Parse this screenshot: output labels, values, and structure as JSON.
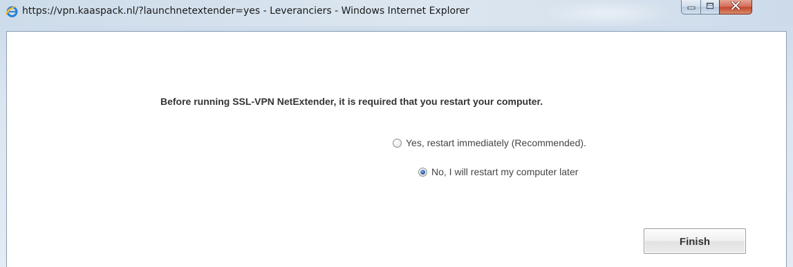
{
  "window": {
    "title": "https://vpn.kaaspack.nl/?launchnetextender=yes - Leveranciers - Windows Internet Explorer",
    "app_icon": "internet-explorer-icon",
    "controls": {
      "minimize_icon": "minimize-icon",
      "maximize_icon": "maximize-icon",
      "close_icon": "close-icon"
    }
  },
  "dialog": {
    "message": "Before running SSL-VPN NetExtender, it is required that you restart your computer.",
    "options": [
      {
        "label": "Yes, restart immediately (Recommended).",
        "selected": false
      },
      {
        "label": "No, I will restart my computer later",
        "selected": true
      }
    ],
    "finish_label": "Finish"
  },
  "colors": {
    "accent": "#2c62a8",
    "close_button": "#c3482f"
  }
}
